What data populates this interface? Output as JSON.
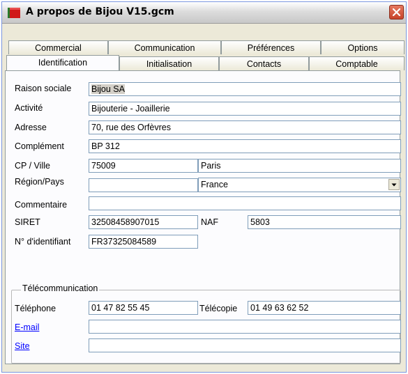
{
  "window": {
    "title": "A propos de Bijou V15.gcm"
  },
  "tabs_row1": [
    "Commercial",
    "Communication",
    "Préférences",
    "Options"
  ],
  "tabs_row2": [
    "Identification",
    "Initialisation",
    "Contacts",
    "Comptable"
  ],
  "active_tab": "Identification",
  "form": {
    "raison_sociale": {
      "label": "Raison sociale",
      "value": "Bijou SA"
    },
    "activite": {
      "label": "Activité",
      "value": "Bijouterie - Joaillerie"
    },
    "adresse": {
      "label": "Adresse",
      "value": "70, rue des Orfèvres"
    },
    "complement": {
      "label": "Complément",
      "value": "BP 312"
    },
    "cp_ville": {
      "label": "CP / Ville",
      "cp": "75009",
      "ville": "Paris"
    },
    "region_pays": {
      "label": "Région/Pays",
      "region": "",
      "pays": "France"
    },
    "commentaire": {
      "label": "Commentaire",
      "value": ""
    },
    "siret": {
      "label": "SIRET",
      "value": "32508458907015"
    },
    "naf": {
      "label": "NAF",
      "value": "5803"
    },
    "identifiant": {
      "label": "N° d'identifiant",
      "value": "FR37325084589"
    }
  },
  "telecom": {
    "title": "Télécommunication",
    "telephone": {
      "label": "Téléphone",
      "value": "01 47 82 55 45"
    },
    "telecopie": {
      "label": "Télécopie",
      "value": "01 49 63 62 52"
    },
    "email": {
      "label": "E-mail",
      "value": ""
    },
    "site": {
      "label": "Site",
      "value": ""
    }
  },
  "colors": {
    "link": "#0000ff",
    "window_bg": "#ece9d8",
    "close_button": "#c8432a"
  }
}
